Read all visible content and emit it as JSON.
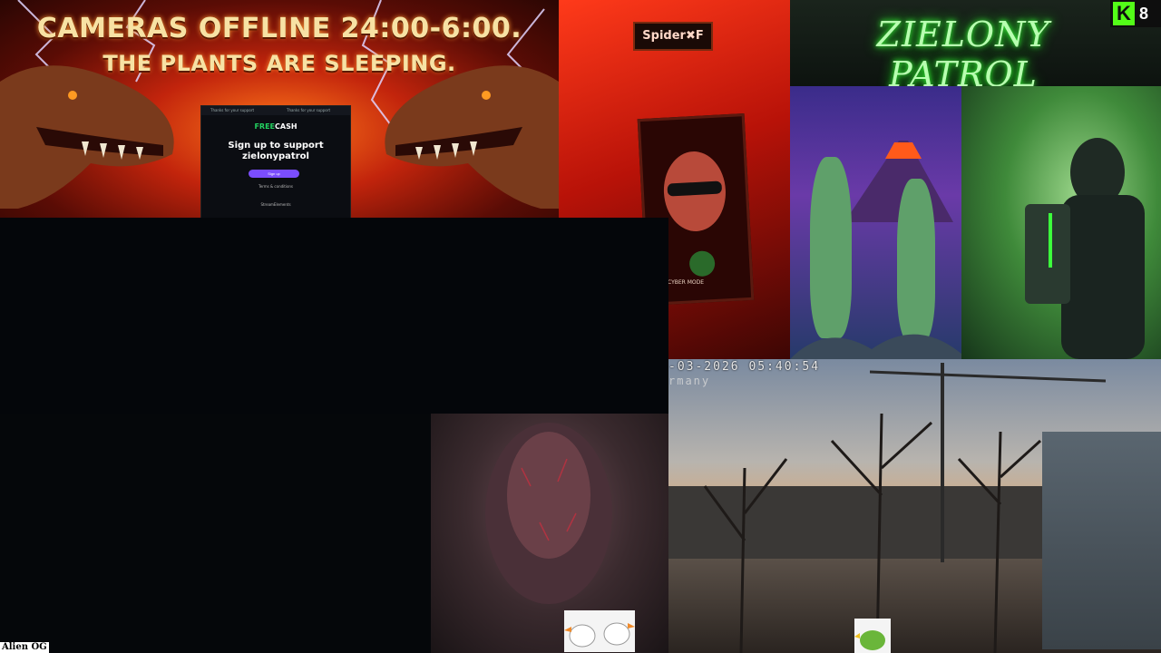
{
  "banner": {
    "line1": "CAMERAS OFFLINE 24:00-6:00.",
    "line2": "THE PLANTS ARE SLEEPING."
  },
  "freecash": {
    "topbar_left": "Thanks for your support",
    "topbar_right": "Thanks for your support",
    "logo_prefix": "FREE",
    "logo_suffix": "CASH",
    "title": "Sign up to support",
    "username": "zielonypatrol",
    "button_label": "Sign up",
    "small_text": "Terms & conditions",
    "footer": "StreamElements"
  },
  "spider": {
    "sign": "Spider✖F",
    "poster_label": "CYBER MODE"
  },
  "patrol": {
    "neon_text": "ZIELONY PATROL"
  },
  "kick": {
    "icon": "K",
    "viewer_count": "8"
  },
  "camera": {
    "timestamp": "-03-2026 05:40:54",
    "location": "rmany"
  },
  "labels": {
    "alien_og": "Alien OG"
  },
  "colors": {
    "kick_green": "#53fc18",
    "neon_green": "#3cff3c",
    "freecash_purple": "#7b4dff"
  }
}
